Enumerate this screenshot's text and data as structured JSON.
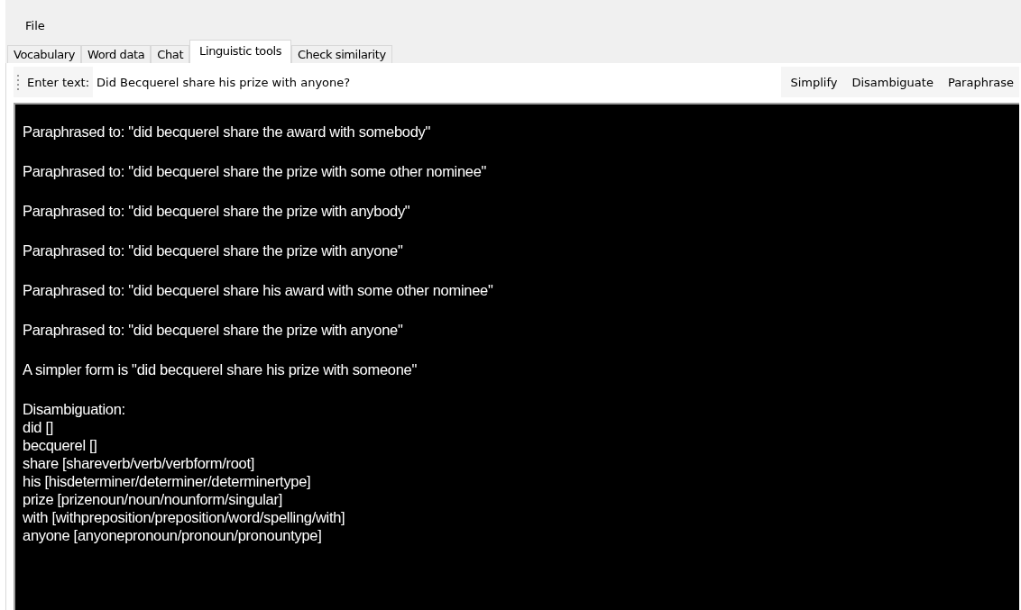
{
  "menu": [
    "File"
  ],
  "tabs": [
    {
      "label": "Vocabulary",
      "selected": false
    },
    {
      "label": "Word data",
      "selected": false
    },
    {
      "label": "Chat",
      "selected": false
    },
    {
      "label": "Linguistic tools",
      "selected": true
    },
    {
      "label": "Check similarity",
      "selected": false
    }
  ],
  "toolbar": {
    "label": "Enter text:",
    "value": "Did Becquerel share his prize with anyone?",
    "buttons": [
      "Simplify",
      "Disambiguate",
      "Paraphrase"
    ]
  },
  "output": [
    {
      "lines": [
        "Paraphrased to: \"did becquerel share the award with somebody\""
      ]
    },
    {
      "lines": [
        "Paraphrased to: \"did becquerel share the prize with some other nominee\""
      ]
    },
    {
      "lines": [
        "Paraphrased to: \"did becquerel share the prize with anybody\""
      ]
    },
    {
      "lines": [
        "Paraphrased to: \"did becquerel share the prize with anyone\""
      ]
    },
    {
      "lines": [
        "Paraphrased to: \"did becquerel share his award with some other nominee\""
      ]
    },
    {
      "lines": [
        "Paraphrased to: \"did becquerel share the prize with anyone\""
      ]
    },
    {
      "lines": [
        "A simpler form is \"did becquerel share his prize with someone\""
      ]
    },
    {
      "lines": [
        "Disambiguation:",
        "did []",
        "becquerel []",
        "share [shareverb/verb/verbform/root]",
        "his [hisdeterminer/determiner/determinertype]",
        "prize [prizenoun/noun/nounform/singular]",
        "with [withpreposition/preposition/word/spelling/with]",
        "anyone [anyonepronoun/pronoun/pronountype]"
      ]
    }
  ]
}
